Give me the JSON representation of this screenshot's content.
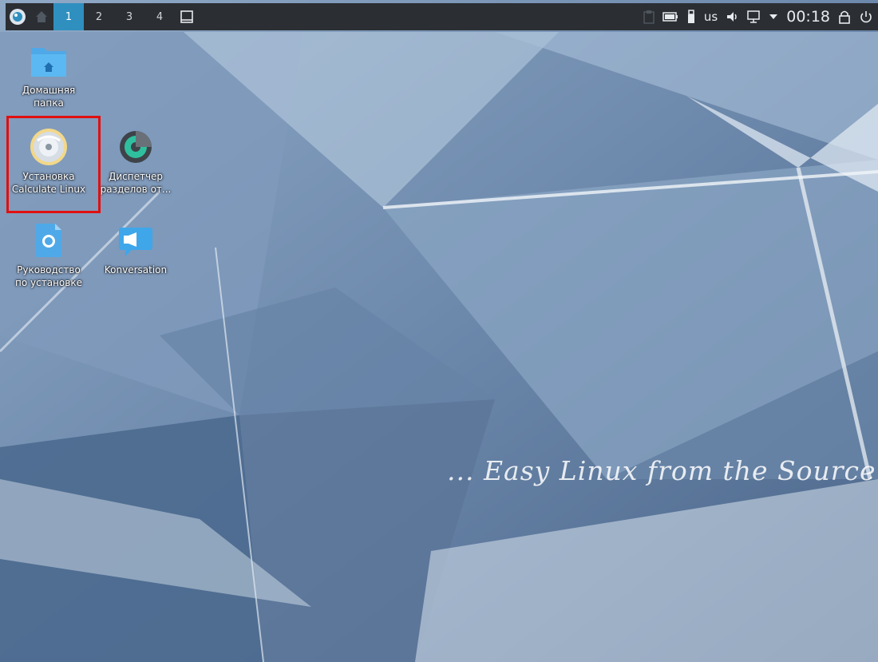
{
  "taskbar": {
    "pager": [
      "1",
      "2",
      "3",
      "4"
    ],
    "active_desktop": "1",
    "keyboard_layout": "us",
    "clock": "00:18"
  },
  "desktop_icons": [
    {
      "label": "Домашняя\nпапка",
      "icon": "folder-home-icon"
    },
    {
      "label": "Установка\nCalculate Linux",
      "icon": "installer-disc-icon"
    },
    {
      "label": "Диспетчер\nразделов от...",
      "icon": "partition-manager-icon"
    },
    {
      "label": "Руководство\nпо установке",
      "icon": "web-document-icon"
    },
    {
      "label": "Konversation",
      "icon": "konversation-icon"
    }
  ],
  "wallpaper": {
    "slogan": "... Easy Linux from the Source"
  },
  "colors": {
    "panel": "#2b2e33",
    "active_desktop": "#2f8fbf",
    "highlight": "#e01010"
  }
}
